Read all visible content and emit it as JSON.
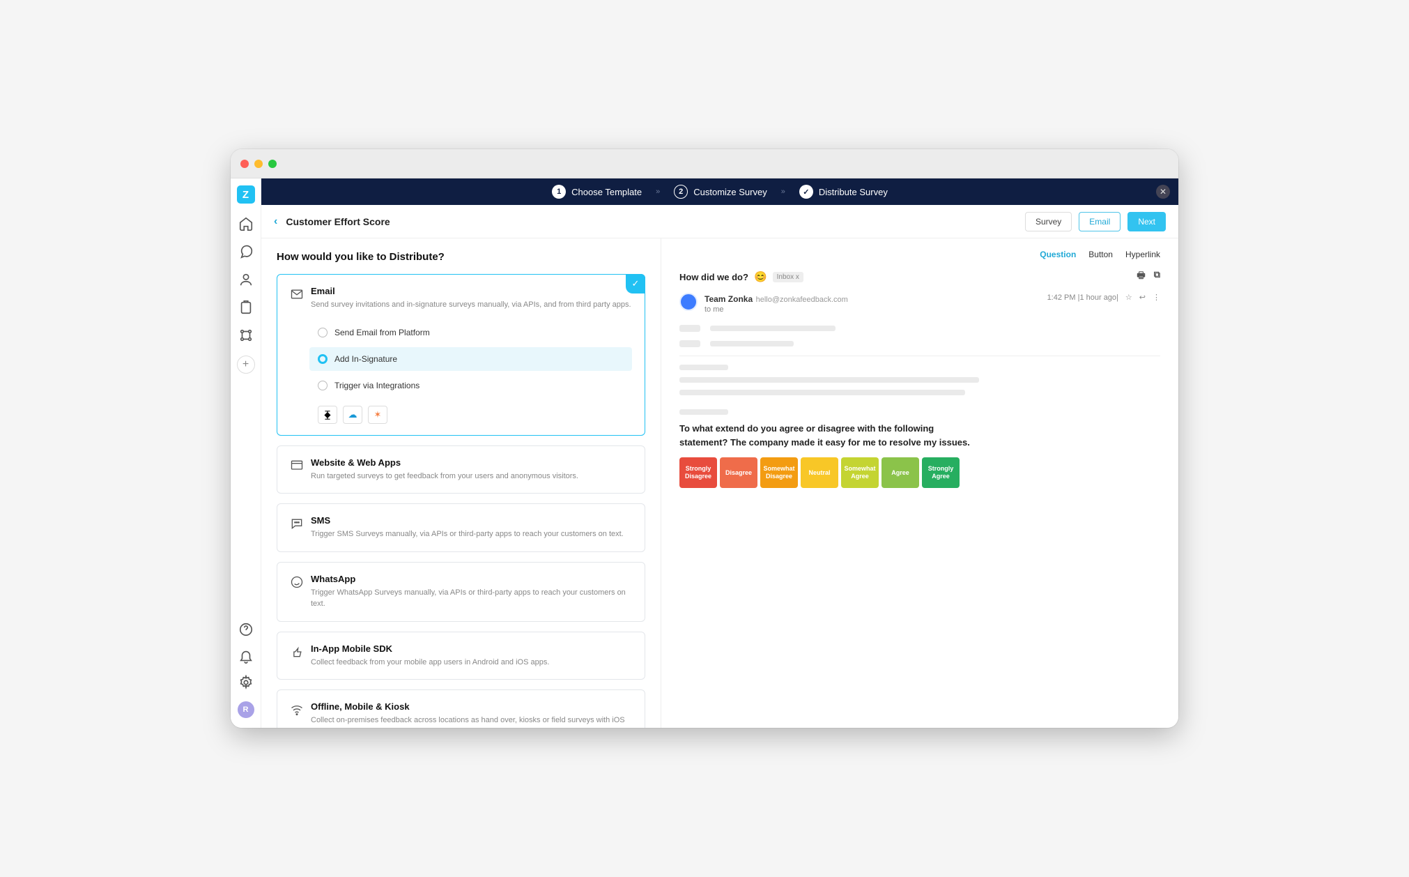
{
  "steps": {
    "s1": "Choose Template",
    "s2": "Customize Survey",
    "s3": "Distribute Survey"
  },
  "toolbar": {
    "breadcrumb": "Customer Effort Score",
    "survey_btn": "Survey",
    "email_btn": "Email",
    "next_btn": "Next"
  },
  "left": {
    "heading": "How would you like to Distribute?",
    "email": {
      "title": "Email",
      "desc": "Send survey invitations and in-signature surveys manually, via APIs, and from third party apps.",
      "opt1": "Send Email from Platform",
      "opt2": "Add In-Signature",
      "opt3": "Trigger via Integrations"
    },
    "web": {
      "title": "Website & Web Apps",
      "desc": "Run targeted surveys to get feedback from your users and anonymous visitors."
    },
    "sms": {
      "title": "SMS",
      "desc": "Trigger SMS Surveys manually, via APIs or third-party apps to reach your customers on text."
    },
    "wa": {
      "title": "WhatsApp",
      "desc": "Trigger WhatsApp Surveys manually, via APIs or third-party apps to reach your customers on text."
    },
    "sdk": {
      "title": "In-App Mobile SDK",
      "desc": "Collect feedback from your mobile app users in Android and iOS apps."
    },
    "kiosk": {
      "title": "Offline, Mobile & Kiosk",
      "desc": "Collect on-premises feedback across locations as hand over, kiosks or field surveys with iOS and Android App."
    }
  },
  "tabs": {
    "t1": "Question",
    "t2": "Button",
    "t3": "Hyperlink"
  },
  "email_preview": {
    "subject": "How did we do?",
    "inbox": "Inbox x",
    "sender_name": "Team Zonka",
    "sender_email": "hello@zonkafeedback.com",
    "to": "to me",
    "time": "1:42 PM |1 hour ago|",
    "question": "To what extend do you agree or disagree with the following statement? The company made it easy for me to resolve my issues.",
    "scale": [
      {
        "label": "Strongly Disagree",
        "color": "#e84c3d"
      },
      {
        "label": "Disagree",
        "color": "#ef6c4a"
      },
      {
        "label": "Somewhat Disagree",
        "color": "#f39c12"
      },
      {
        "label": "Neutral",
        "color": "#f8c727"
      },
      {
        "label": "Somewhat Agree",
        "color": "#c4d432"
      },
      {
        "label": "Agree",
        "color": "#8bc34a"
      },
      {
        "label": "Strongly Agree",
        "color": "#27ae60"
      }
    ]
  },
  "avatar_initial": "R"
}
